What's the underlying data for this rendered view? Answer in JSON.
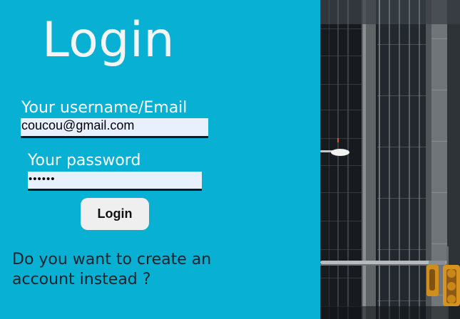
{
  "login_form": {
    "title": "Login",
    "username_label": "Your username/Email",
    "username_value": "coucou@gmail.com",
    "password_label": "Your password",
    "password_value": "••••••",
    "submit_label": "Login",
    "create_account_text": "Do you want to create an account instead ?"
  },
  "colors": {
    "panel_background": "#08b0d4",
    "input_background": "#e8f0fe",
    "button_background": "#efefef"
  }
}
